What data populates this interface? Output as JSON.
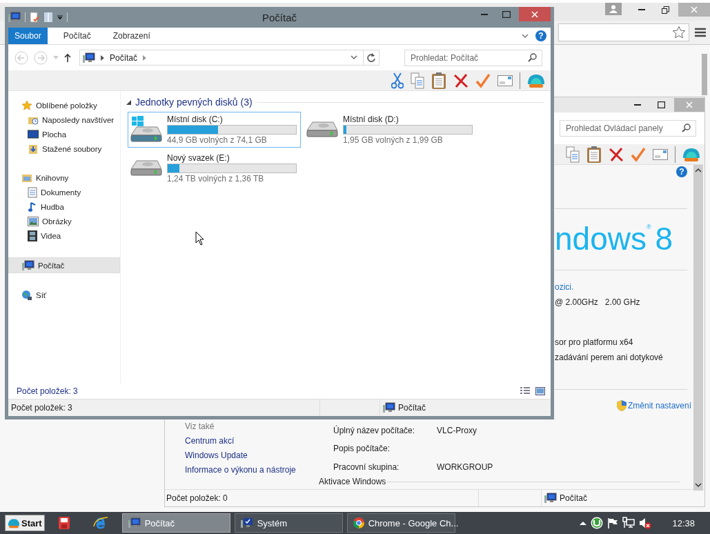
{
  "explorer": {
    "title": "Počítač",
    "help_label": "?",
    "ribbon_tabs": [
      {
        "label": "Soubor",
        "selected": true
      },
      {
        "label": "Počítač",
        "selected": false
      },
      {
        "label": "Zobrazení",
        "selected": false
      }
    ],
    "address": {
      "crumbs": [
        "Počítač"
      ]
    },
    "search": {
      "placeholder": "Prohledat: Počítač"
    },
    "nav": [
      {
        "label": "Oblíbené položky",
        "kind": "star",
        "selected": false,
        "children": [
          {
            "label": "Naposledy navštíver",
            "kind": "recent",
            "selected": false
          },
          {
            "label": "Plocha",
            "kind": "desktop",
            "selected": false
          },
          {
            "label": "Stažené soubory",
            "kind": "downloads",
            "selected": false
          }
        ]
      },
      {
        "label": "Knihovny",
        "kind": "library",
        "selected": false,
        "children": [
          {
            "label": "Dokumenty",
            "kind": "documents",
            "selected": false
          },
          {
            "label": "Hudba",
            "kind": "music",
            "selected": false
          },
          {
            "label": "Obrázky",
            "kind": "pictures",
            "selected": false
          },
          {
            "label": "Videa",
            "kind": "videos",
            "selected": false
          }
        ]
      },
      {
        "label": "Počítač",
        "kind": "computer",
        "selected": true
      },
      {
        "label": "Síť",
        "kind": "network",
        "selected": false
      }
    ],
    "group": {
      "title": "Jednotky pevných disků (3)",
      "expanded": true
    },
    "drives": [
      {
        "name": "Místní disk (C:)",
        "kind": "system",
        "level": 0.39,
        "free": "44,9 GB volných z 74,1 GB",
        "selected": true
      },
      {
        "name": "Místní disk (D:)",
        "kind": "local",
        "level": 0.02,
        "free": "1,95 GB volných z 1,99 GB",
        "selected": false
      },
      {
        "name": "Nový svazek (E:)",
        "kind": "local",
        "level": 0.09,
        "free": "1,24 TB volných z 1,36 TB",
        "selected": false
      }
    ],
    "details_count": "Počet položek: 3",
    "status_bar": {
      "item_count": "Počet položek: 3",
      "location": "Počítač"
    }
  },
  "system_window": {
    "help_label": "?",
    "search": {
      "placeholder": "Prohledat Ovládací panely"
    },
    "logo_text": "ndows$^{®}$8",
    "info_groups": [
      {
        "lines": [
          {
            "text": "ozici.",
            "kind": "link"
          },
          {
            "text": "@ 2.00GHz   2.00 GHz",
            "kind": "text"
          }
        ]
      },
      {
        "lines": [
          {
            "text": "sor pro platformu x64",
            "kind": "text"
          },
          {
            "text": "zadávání perem ani dotykové",
            "kind": "text"
          }
        ]
      }
    ],
    "change_settings": "Změnit nastavení",
    "see_also": {
      "title": "Viz také",
      "links": [
        "Centrum akcí",
        "Windows Update",
        "Informace o výkonu a nástroje"
      ]
    },
    "properties": [
      {
        "label": "Úplný název počítače:",
        "value": "VLC-Proxy"
      },
      {
        "label": "Popis počítače:"
      },
      {
        "label": "Pracovní skupina:",
        "value": "WORKGROUP"
      }
    ],
    "section_title": "Aktivace Windows",
    "status_bar": {
      "item_count": "Počet položek: 0",
      "location": "Počítač"
    }
  },
  "taskbar": {
    "start": "Start",
    "tasks": [
      {
        "label": "Počítač",
        "kind": "computer",
        "selected": true
      },
      {
        "label": "Systém",
        "kind": "system",
        "selected": false
      },
      {
        "label": "Chrome - Google Ch...",
        "kind": "chrome",
        "selected": false
      }
    ],
    "clock": "12:38"
  }
}
